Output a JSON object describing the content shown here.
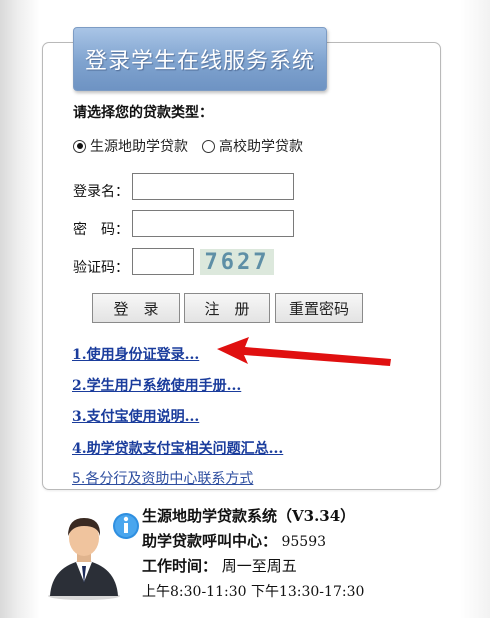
{
  "header": {
    "title": "登录学生在线服务系统"
  },
  "loan_type": {
    "label": "请选择您的贷款类型：",
    "options": [
      {
        "label": "生源地助学贷款",
        "checked": true
      },
      {
        "label": "高校助学贷款",
        "checked": false
      }
    ]
  },
  "form": {
    "username_label": "登录名：",
    "password_label": "密　码：",
    "captcha_label": "验证码：",
    "captcha_code": "7627"
  },
  "buttons": {
    "login": "登　录",
    "register": "注　册",
    "reset_password": "重置密码"
  },
  "links": [
    "1.使用身份证登录...",
    "2.学生用户系统使用手册...",
    "3.支付宝使用说明...",
    "4.助学贷款支付宝相关问题汇总...",
    "5.各分行及资助中心联系方式"
  ],
  "info": {
    "system": "生源地助学贷款系统（V3.34）",
    "hotline_label": "助学贷款呼叫中心：",
    "hotline_number": "95593",
    "hours_label": "工作时间：",
    "hours_days": "周一至周五",
    "hours_times": "上午8:30-11:30 下午13:30-17:30"
  },
  "colors": {
    "accent": "#6e93c3",
    "link": "#1a3c9c",
    "arrow": "#e01010"
  }
}
